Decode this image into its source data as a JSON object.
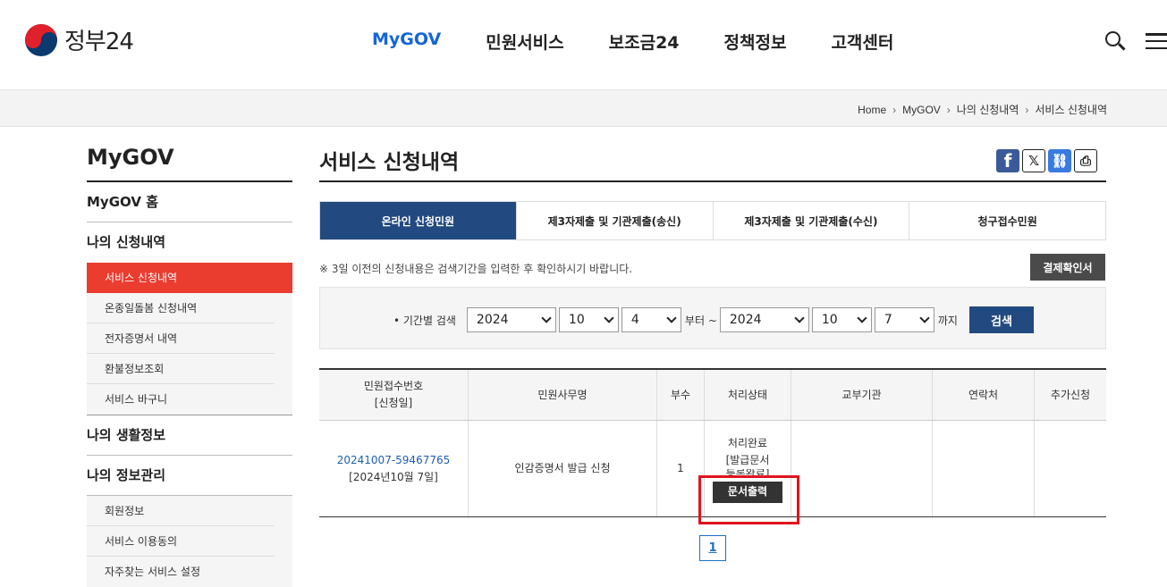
{
  "header": {
    "logo_text": "정부24",
    "nav": [
      "MyGOV",
      "민원서비스",
      "보조금24",
      "정책정보",
      "고객센터"
    ],
    "active_nav": "MyGOV"
  },
  "breadcrumb": [
    "Home",
    "MyGOV",
    "나의 신청내역",
    "서비스 신청내역"
  ],
  "sidebar": {
    "title": "MyGOV",
    "home": "MyGOV 홈",
    "section1": "나의 신청내역",
    "section1_items": [
      "서비스 신청내역",
      "온종일돌봄 신청내역",
      "전자증명서 내역",
      "환불정보조회",
      "서비스 바구니"
    ],
    "section2": "나의 생활정보",
    "section3": "나의 정보관리",
    "section3_items": [
      "회원정보",
      "서비스 이용동의",
      "자주찾는 서비스 설정"
    ]
  },
  "main": {
    "title": "서비스 신청내역",
    "tabs": [
      "온라인 신청민원",
      "제3자제출 및 기관제출(송신)",
      "제3자제출 및 기관제출(수신)",
      "청구접수민원"
    ],
    "notice": "※ 3일 이전의 신청내용은 검색기간을 입력한 후 확인하시기 바랍니다.",
    "confirm_button": "결제확인서",
    "search": {
      "label": "• 기간별 검색",
      "from_year": "2024",
      "from_month": "10",
      "from_day": "4",
      "from_text": "부터 ~",
      "to_year": "2024",
      "to_month": "10",
      "to_day": "7",
      "to_text": "까지",
      "button": "검색"
    },
    "table": {
      "headers": [
        "민원접수번호",
        "[신청일]",
        "민원사무명",
        "부수",
        "처리상태",
        "교부기관",
        "연락처",
        "추가신청"
      ],
      "row": {
        "receipt_no": "20241007-59467765",
        "date": "[2024년10월 7일]",
        "name": "인감증명서 발급 신청",
        "copies": "1",
        "status1": "처리완료",
        "status2": "[발급문서",
        "status3": "등록완료]",
        "print_button": "문서출력"
      }
    },
    "page": "1"
  }
}
